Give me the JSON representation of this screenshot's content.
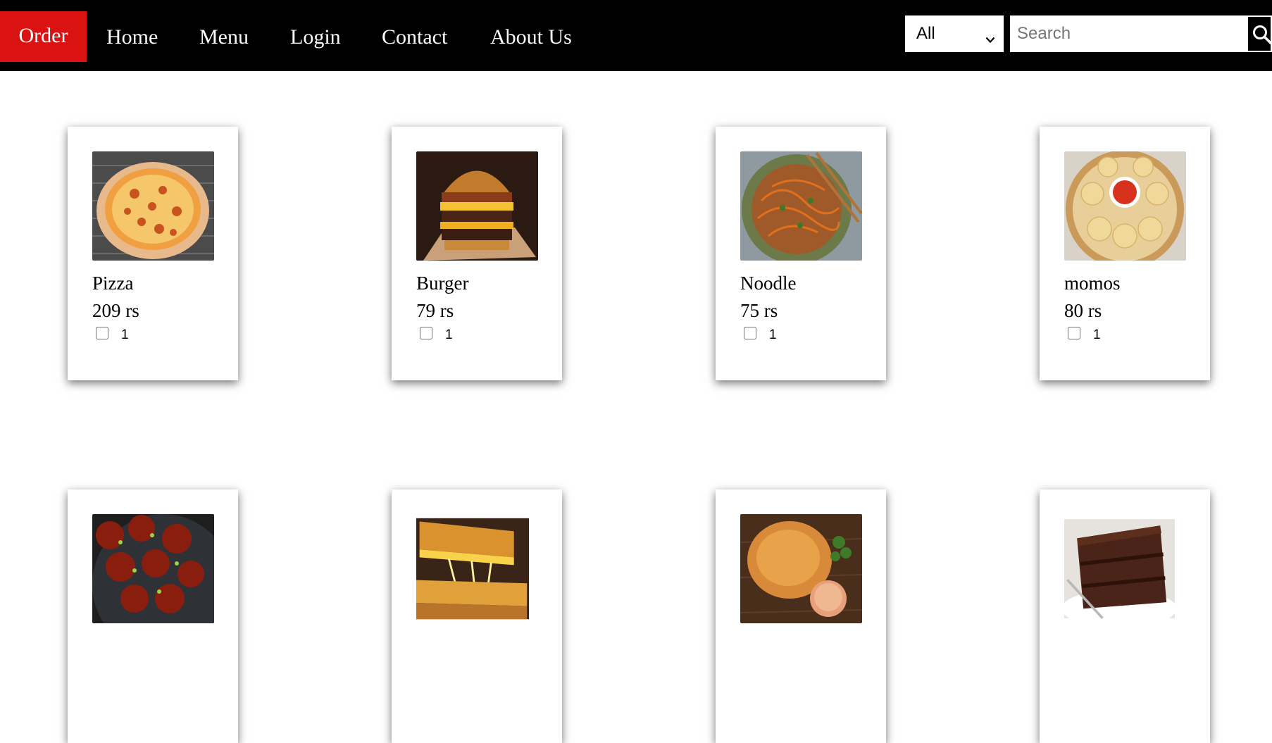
{
  "nav": {
    "brand": "Order",
    "links": [
      "Home",
      "Menu",
      "Login",
      "Contact",
      "About Us"
    ],
    "category_select": {
      "selected": "All"
    },
    "search": {
      "placeholder": "Search"
    }
  },
  "items": [
    {
      "name": "Pizza",
      "price": "209 rs",
      "quantity": "1"
    },
    {
      "name": "Burger",
      "price": "79 rs",
      "quantity": "1"
    },
    {
      "name": "Noodle",
      "price": "75 rs",
      "quantity": "1"
    },
    {
      "name": "momos",
      "price": "80 rs",
      "quantity": "1"
    },
    {
      "name": "",
      "price": "",
      "quantity": ""
    },
    {
      "name": "",
      "price": "",
      "quantity": ""
    },
    {
      "name": "",
      "price": "",
      "quantity": ""
    },
    {
      "name": "",
      "price": "",
      "quantity": ""
    }
  ],
  "colors": {
    "navbar_bg": "#000000",
    "brand_bg": "#db1212",
    "text_light": "#ffffff"
  }
}
